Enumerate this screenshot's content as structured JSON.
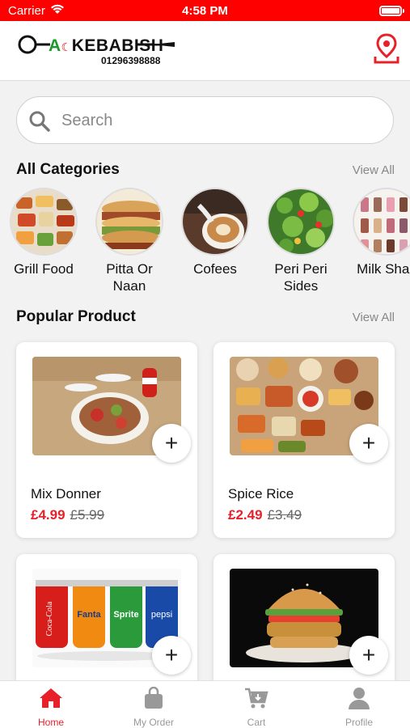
{
  "status": {
    "carrier": "Carrier",
    "time": "4:58 PM"
  },
  "brand": {
    "name_part1": "A",
    "name_part2": "KEBABISH",
    "phone": "01296398888"
  },
  "search": {
    "placeholder": "Search"
  },
  "categories_section": {
    "title": "All Categories",
    "view_all": "View All",
    "items": [
      {
        "label": "Grill Food"
      },
      {
        "label": "Pitta Or\nNaan"
      },
      {
        "label": "Cofees"
      },
      {
        "label": "Peri Peri\nSides"
      },
      {
        "label": "Milk Shak"
      }
    ]
  },
  "popular_section": {
    "title": "Popular Product",
    "view_all": "View All",
    "products": [
      {
        "name": "Mix Donner",
        "price": "£4.99",
        "old_price": "£5.99"
      },
      {
        "name": "Spice Rice",
        "price": "£2.49",
        "old_price": "£3.49"
      },
      {
        "name": "",
        "price": "",
        "old_price": ""
      },
      {
        "name": "",
        "price": "",
        "old_price": ""
      }
    ]
  },
  "tabbar": {
    "tabs": [
      {
        "label": "Home",
        "icon": "home-icon",
        "active": true
      },
      {
        "label": "My Order",
        "icon": "bag-icon",
        "active": false
      },
      {
        "label": "Cart",
        "icon": "cart-icon",
        "active": false
      },
      {
        "label": "Profile",
        "icon": "person-icon",
        "active": false
      }
    ]
  },
  "colors": {
    "accent": "#e8202a",
    "status_bar": "#ff0000"
  }
}
